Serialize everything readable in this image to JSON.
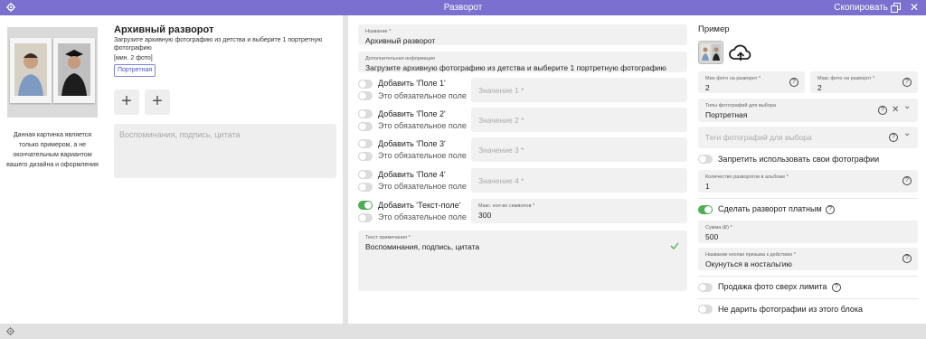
{
  "topbar": {
    "title": "Разворот",
    "copy_label": "Скопировать",
    "close": "✕"
  },
  "preview": {
    "caption": "Данная картинка является только примером, а не окончательным вариантом вашего дизайна и оформления",
    "title": "Архивный разворот",
    "description": "Загрузите архивную фотографию из детства и выберите 1 портретную фотографию",
    "count": "[мин. 2 фото]",
    "chip": "Портретная",
    "plus_1": "+",
    "plus_2": "+",
    "memo": "Воспоминания, подпись, цитата"
  },
  "form": {
    "name_label": "Название *",
    "name_value": "Архивный разворот",
    "info_label": "Дополнительная информация",
    "info_value": "Загрузите архивную фотографию из детства и выберите 1 портретную фотографию",
    "fields": [
      {
        "label": "Добавить 'Поле 1'",
        "required": "Это обязательное поле",
        "placeholder": "Значение 1 *"
      },
      {
        "label": "Добавить 'Поле 2'",
        "required": "Это обязательное поле",
        "placeholder": "Значение 2 *"
      },
      {
        "label": "Добавить 'Поле 3'",
        "required": "Это обязательное поле",
        "placeholder": "Значение 3 *"
      },
      {
        "label": "Добавить 'Поле 4'",
        "required": "Это обязательное поле",
        "placeholder": "Значение 4 *"
      }
    ],
    "textfield": {
      "label": "Добавить 'Текст-поле'",
      "required": "Это обязательное поле",
      "max_label": "Макс. кол-во символов *",
      "max_value": "300",
      "enabled": true
    },
    "note_label": "Текст примечания *",
    "note_value": "Воспоминания, подпись, цитата"
  },
  "settings": {
    "example_title": "Пример",
    "min_label": "Мин фото на разворот *",
    "min_value": "2",
    "max_label": "Макс фото на разворот *",
    "max_value": "2",
    "types_label": "Типы фотографий для выбора",
    "types_value": "Портретная",
    "tags_placeholder": "Теги фотографий для выбора",
    "forbid_label": "Запретить использовать свои фотографии",
    "spreads_label": "Количество разворотов в альбоме *",
    "spreads_value": "1",
    "paid_label": "Сделать разворот платным",
    "sum_label": "Сумма (₽) *",
    "sum_value": "500",
    "cta_label": "Название кнопки призыва к действию *",
    "cta_value": "Окунуться в ностальгию",
    "sell_label": "Продажа фото сверх лимита",
    "nogift_label": "Не дарить фотографии из этого блока",
    "help": "?",
    "clear": "✕",
    "chevron": "⌄"
  },
  "colors": {
    "accent": "#7b6fcf",
    "toggle_on": "#4caf50",
    "chip": "#4b57c6"
  }
}
